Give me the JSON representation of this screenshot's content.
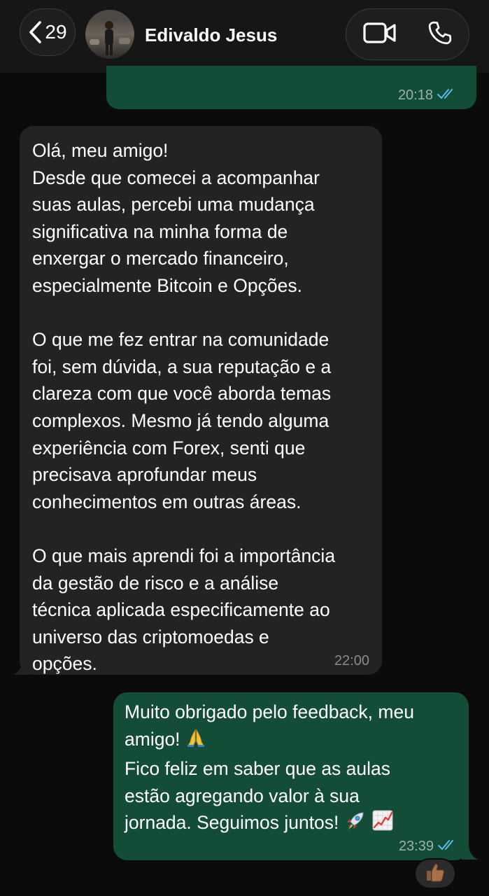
{
  "header": {
    "back_count": "29",
    "contact_name": "Edivaldo Jesus",
    "icons": {
      "back": "chevron-left-icon",
      "video": "video-camera-icon",
      "phone": "phone-icon"
    }
  },
  "messages": [
    {
      "direction": "outgoing",
      "time": "20:18",
      "status": "read"
    },
    {
      "direction": "incoming",
      "paragraphs": [
        "Olá, meu amigo!\nDesde que comecei a acompanhar suas aulas, percebi uma mudança significativa na minha forma de enxergar o mercado financeiro, especialmente Bitcoin e Opções.",
        "O que me fez entrar na comunidade foi, sem dúvida, a sua reputação e a clareza com que você aborda temas complexos. Mesmo já tendo alguma experiência com Forex, senti que precisava aprofundar meus conhecimentos em outras áreas.",
        "O que mais aprendi foi a importância da gestão de risco e a análise técnica aplicada especificamente ao universo das criptomoedas e opções."
      ],
      "lines": [
        "Olá, meu amigo!",
        "Desde que comecei a acompanhar",
        "suas aulas, percebi uma mudança",
        "significativa na minha forma de",
        "enxergar o mercado financeiro,",
        "especialmente Bitcoin e Opções.",
        "O que me fez entrar na comunidade",
        "foi, sem dúvida, a sua reputação e a",
        "clareza com que você aborda temas",
        "complexos. Mesmo já tendo alguma",
        "experiência com Forex, senti que",
        "precisava aprofundar meus",
        "conhecimentos em outras áreas.",
        "O que mais aprendi foi a importância",
        "da gestão de risco e a análise",
        "técnica aplicada especificamente ao",
        "universo das criptomoedas e",
        "opções."
      ],
      "time": "22:00"
    },
    {
      "direction": "outgoing",
      "lines": [
        "Muito obrigado pelo feedback, meu",
        "amigo!",
        "Fico feliz em saber que as aulas",
        "estão agregando valor à sua",
        "jornada. Seguimos juntos!"
      ],
      "emojis": {
        "line2": "folded-hands-emoji",
        "line5": [
          "rocket-emoji",
          "chart-increasing-emoji"
        ]
      },
      "time": "23:39",
      "status": "read",
      "reaction": "thumbs-up-emoji"
    }
  ],
  "colors": {
    "header_bg": "#161616",
    "chat_bg": "#0b0b0b",
    "outgoing_bubble": "#134d37",
    "incoming_bubble": "#232323",
    "read_ticks": "#53bdeb",
    "outgoing_time": "#9eb0a6",
    "incoming_time": "#8a8a8a"
  }
}
